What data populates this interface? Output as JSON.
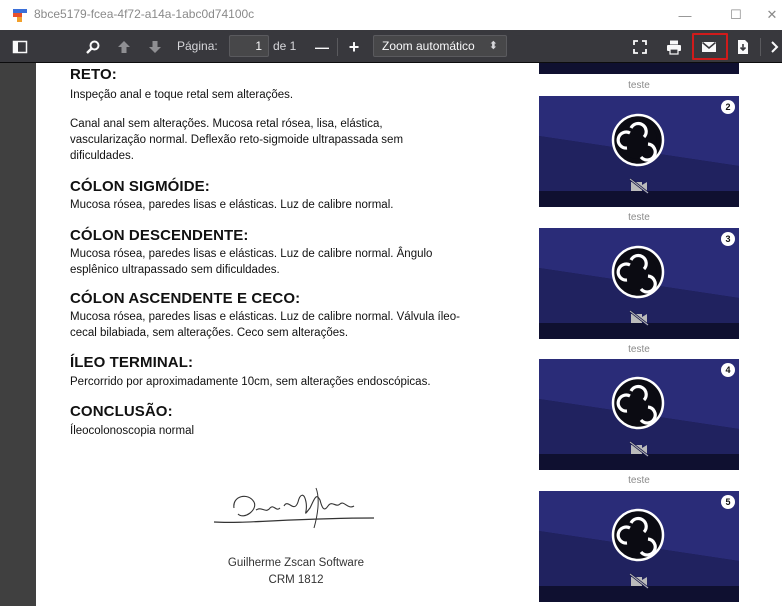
{
  "window": {
    "title": "8bce5179-fcea-4f72-a14a-1abc0d74100c",
    "minimize_label": "—",
    "maximize_label": "☐",
    "close_label": "✕"
  },
  "toolbar": {
    "page_label": "Página:",
    "page_value": "1",
    "page_count": "de 1",
    "zoom_out_label": "—",
    "zoom_in_label": "+",
    "zoom_value": "Zoom automático",
    "zoom_arrow": "⬍"
  },
  "document": {
    "sections": [
      {
        "heading": "RETO:",
        "paragraphs": [
          "Inspeção anal e toque retal sem alterações.",
          "Canal anal sem alterações. Mucosa retal rósea, lisa, elástica, vascularização normal. Deflexão reto-sigmoide ultrapassada sem dificuldades."
        ]
      },
      {
        "heading": "CÓLON SIGMÓIDE:",
        "paragraphs": [
          "Mucosa rósea, paredes lisas e elásticas. Luz de calibre normal."
        ]
      },
      {
        "heading": "CÓLON DESCENDENTE:",
        "paragraphs": [
          "Mucosa rósea, paredes lisas e elásticas. Luz de calibre normal. Ângulo esplênico ultrapassado sem dificuldades."
        ]
      },
      {
        "heading": "CÓLON ASCENDENTE E CECO:",
        "paragraphs": [
          "Mucosa rósea, paredes lisas e elásticas. Luz de calibre normal. Válvula íleo-cecal bilabiada, sem alterações. Ceco sem alterações."
        ]
      },
      {
        "heading": "ÍLEO TERMINAL:",
        "paragraphs": [
          "Percorrido por aproximadamente 10cm, sem alterações endoscópicas."
        ]
      },
      {
        "heading": "CONCLUSÃO:",
        "paragraphs": [
          "Íleocolonoscopia normal"
        ]
      }
    ],
    "signer_name": "Guilherme Zscan Software",
    "signer_crm": "CRM 1812"
  },
  "thumbnails": [
    {
      "number": "",
      "label": "teste"
    },
    {
      "number": "2",
      "label": "teste"
    },
    {
      "number": "3",
      "label": "teste"
    },
    {
      "number": "4",
      "label": "teste"
    },
    {
      "number": "5",
      "label": ""
    }
  ],
  "colors": {
    "toolbar_bg": "#38383d",
    "highlight": "#d11b1b",
    "thumb_bg": "#1a1b4a"
  }
}
